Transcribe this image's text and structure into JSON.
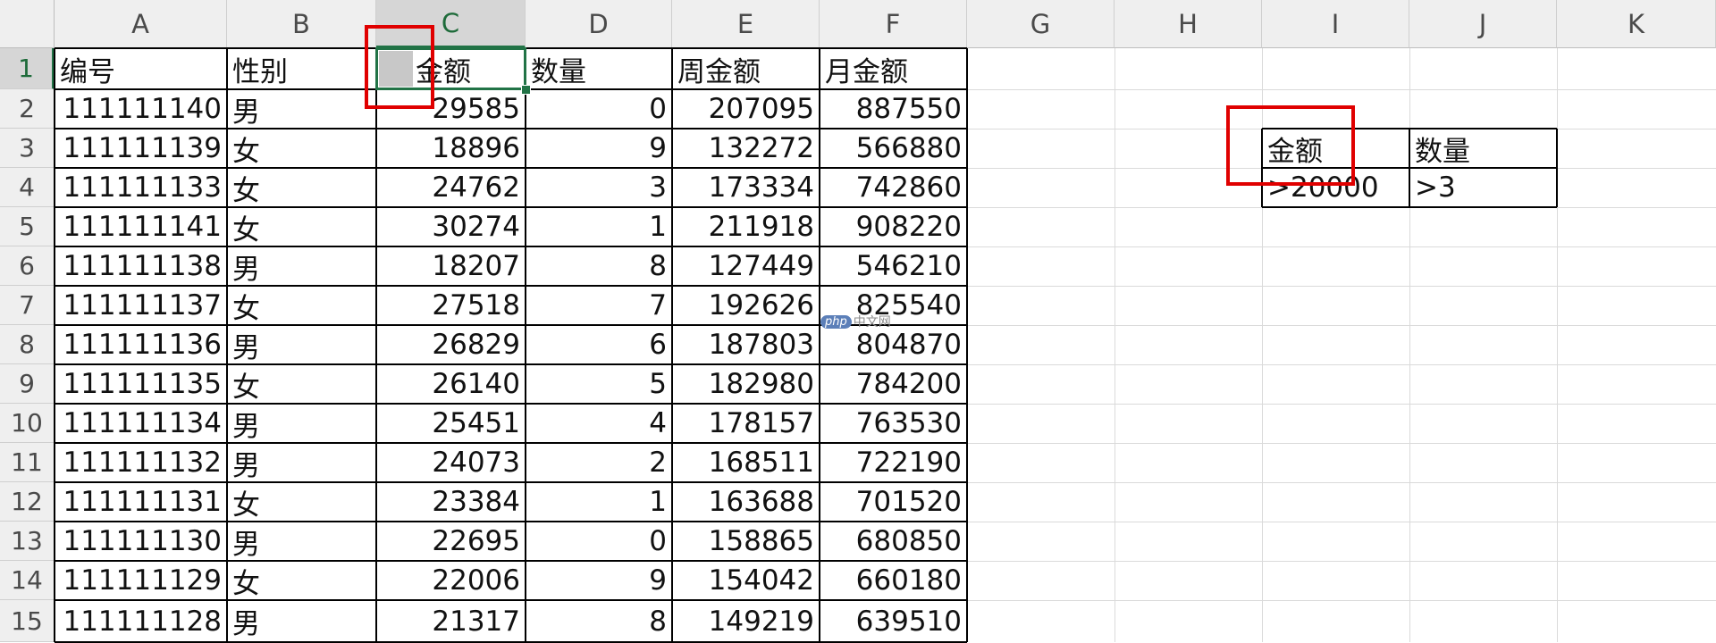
{
  "column_headers": [
    "A",
    "B",
    "C",
    "D",
    "E",
    "F",
    "G",
    "H",
    "I",
    "J",
    "K"
  ],
  "row_headers": [
    "1",
    "2",
    "3",
    "4",
    "5",
    "6",
    "7",
    "8",
    "9",
    "10",
    "11",
    "12",
    "13",
    "14",
    "15"
  ],
  "table": {
    "headers": [
      "编号",
      "性别",
      "金额",
      "数量",
      "周金额",
      "月金额"
    ],
    "rows": [
      [
        "111111140",
        "男",
        "29585",
        "0",
        "207095",
        "887550"
      ],
      [
        "111111139",
        "女",
        "18896",
        "9",
        "132272",
        "566880"
      ],
      [
        "111111133",
        "女",
        "24762",
        "3",
        "173334",
        "742860"
      ],
      [
        "111111141",
        "女",
        "30274",
        "1",
        "211918",
        "908220"
      ],
      [
        "111111138",
        "男",
        "18207",
        "8",
        "127449",
        "546210"
      ],
      [
        "111111137",
        "女",
        "27518",
        "7",
        "192626",
        "825540"
      ],
      [
        "111111136",
        "男",
        "26829",
        "6",
        "187803",
        "804870"
      ],
      [
        "111111135",
        "女",
        "26140",
        "5",
        "182980",
        "784200"
      ],
      [
        "111111134",
        "男",
        "25451",
        "4",
        "178157",
        "763530"
      ],
      [
        "111111132",
        "男",
        "24073",
        "2",
        "168511",
        "722190"
      ],
      [
        "111111131",
        "女",
        "23384",
        "1",
        "163688",
        "701520"
      ],
      [
        "111111130",
        "男",
        "22695",
        "0",
        "158865",
        "680850"
      ],
      [
        "111111129",
        "女",
        "22006",
        "9",
        "154042",
        "660180"
      ],
      [
        "111111128",
        "男",
        "21317",
        "8",
        "149219",
        "639510"
      ]
    ]
  },
  "criteria": {
    "headers": [
      "金额",
      "数量"
    ],
    "values": [
      ">20000",
      ">3"
    ]
  },
  "selection": {
    "active_cell": "C1"
  },
  "watermark": {
    "logo": "php",
    "text": "中文网"
  },
  "colors": {
    "selection_green": "#217346",
    "annotation_red": "#e00000"
  }
}
